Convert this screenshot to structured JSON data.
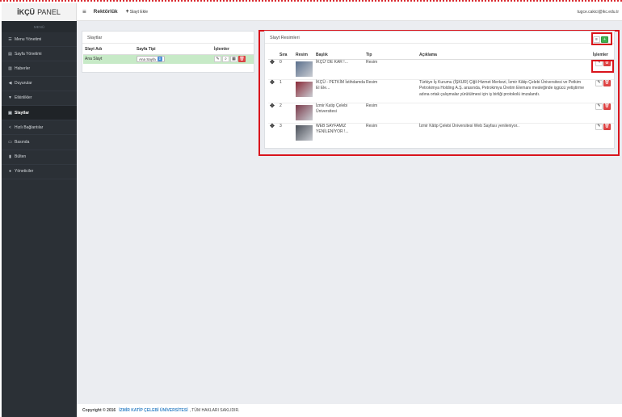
{
  "brand": {
    "bold": "İKÇÜ",
    "light": "PANEL"
  },
  "sidebar": {
    "header": "MENÜ",
    "items": [
      {
        "label": "Menu Yönetimi",
        "icon": "list-icon",
        "glyph": "☰"
      },
      {
        "label": "Sayfa Yönetimi",
        "icon": "file-icon",
        "glyph": "▤"
      },
      {
        "label": "Haberler",
        "icon": "newspaper-icon",
        "glyph": "▥"
      },
      {
        "label": "Duyurular",
        "icon": "bullhorn-icon",
        "glyph": "◀"
      },
      {
        "label": "Etkinlikler",
        "icon": "trophy-icon",
        "glyph": "▼"
      },
      {
        "label": "Slaytlar",
        "icon": "slides-icon",
        "glyph": "▣",
        "active": true
      },
      {
        "label": "Hızlı Bağlantılar",
        "icon": "share-icon",
        "glyph": "<"
      },
      {
        "label": "Basında",
        "icon": "monitor-icon",
        "glyph": "▭"
      },
      {
        "label": "Bülten",
        "icon": "bookmark-icon",
        "glyph": "▮"
      },
      {
        "label": "Yöneticiler",
        "icon": "user-icon",
        "glyph": "●"
      }
    ]
  },
  "topbar": {
    "title": "Rektörlük",
    "add_label": "Slayt Ekle",
    "user": "tugce.cakici@ikc.edu.tr"
  },
  "left_panel": {
    "title": "Slaytlar",
    "columns": [
      "Slayt Adı",
      "Sayfa Tipi",
      "İşlemler"
    ],
    "rows": [
      {
        "name": "Ana Slayt",
        "page_type": "Ana Sayfa"
      }
    ]
  },
  "right_panel": {
    "title": "Slayt Resimleri",
    "columns": [
      "Sıra",
      "Resim",
      "Başlık",
      "Tip",
      "Açıklama",
      "İşlemler"
    ],
    "rows": [
      {
        "order": "0",
        "title": "İKÇÜ' DE KAR !...",
        "type": "Resim",
        "desc": "",
        "thumb_color": "#5a6f8c"
      },
      {
        "order": "1",
        "title": "İKÇÜ - PETKİM İstihdamda El Ele...",
        "type": "Resim",
        "desc": "Türkiye İş Kurumu (İŞKUR) Çiğli Hizmet Merkezi, İzmir Kâtip Çelebi Üniversitesi ve Petkim Petrokimya Holding A.Ş. arasında, Petrokimya Üretim Elemanı mesleğinde işgücü yetiştirme adına ortak çalışmalar yürütülmesi için iş birliği protokolü imzalandı.",
        "thumb_color": "#8a2a38"
      },
      {
        "order": "2",
        "title": "İzmir Katip Çelebi Üniversitesi",
        "type": "Resim",
        "desc": "",
        "thumb_color": "#7a3a4a"
      },
      {
        "order": "3",
        "title": "WEB SAYFAMIZ YENİLENİYOR !...",
        "type": "Resim",
        "desc": "İzmir Kâtip Çelebi Üniversitesi Web Sayfası yenileniyor..",
        "thumb_color": "#4a4f58"
      }
    ]
  },
  "footer": {
    "prefix": "Copyright © 2016",
    "link": "İZMİR KATİP ÇELEBİ ÜNİVERSİTESİ",
    "suffix": ", TÜM HAKLARI SAKLIDIR."
  },
  "colors": {
    "sidebar": "#2b3036",
    "highlight": "#d9141c",
    "row_selected": "#c7eac7",
    "success": "#3fb04f",
    "danger": "#e04646"
  }
}
